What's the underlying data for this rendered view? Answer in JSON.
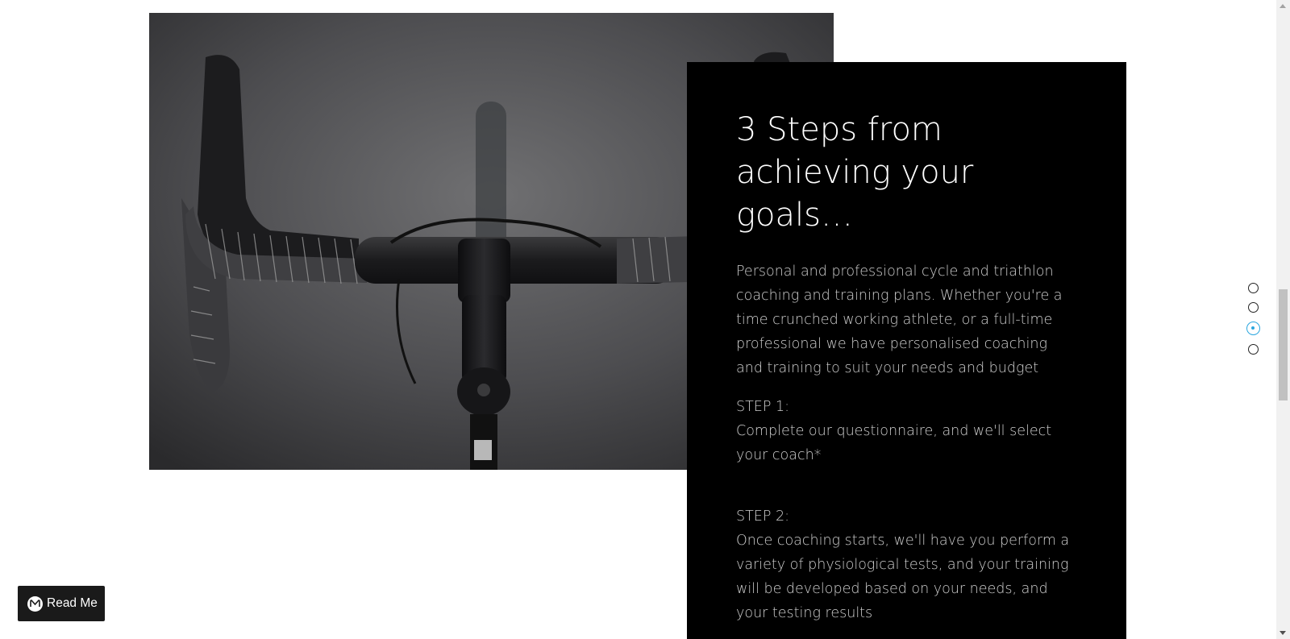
{
  "content": {
    "heading": "3 Steps from achieving your goals…",
    "intro": "Personal and professional cycle and triathlon coaching and training plans. Whether you're a time crunched working athlete, or a full-time professional we have personalised coaching and training to suit your needs and budget",
    "steps": [
      {
        "label": "STEP 1:",
        "text": "Complete our questionnaire, and we'll select your coach*"
      },
      {
        "label": "STEP 2:",
        "text": "Once coaching starts, we'll have you perform a variety of physiological tests, and your training will be developed based on your needs, and your testing results"
      }
    ]
  },
  "dot_nav": {
    "count": 4,
    "active_index": 2,
    "accent_color": "#2aa6df"
  },
  "read_me_button": {
    "label": "Read Me",
    "icon": "m-logo-icon"
  },
  "photo": {
    "subject": "road-bike-handlebars-image"
  }
}
